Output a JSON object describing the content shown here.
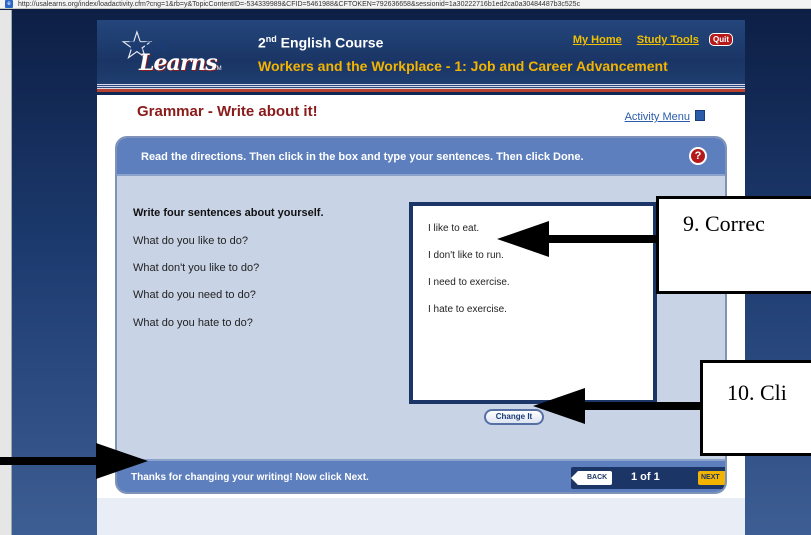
{
  "browser": {
    "url": "http://usalearns.org/index/loadactivity.cfm?cng=1&rb=y&TopicContentID=-534339989&CFID=5461988&CFTOKEN=792636658&sessionid=1a30222716b1ed2ca0a30484487b3c525c"
  },
  "header": {
    "logo_top": "U.S.A.",
    "logo_bottom": "Learns",
    "logo_tm": "TM",
    "course_prefix": "2",
    "course_sup": "nd",
    "course_suffix": " English Course",
    "unit_title": "Workers and the Workplace - 1: Job and Career Advancement",
    "my_home": "My Home",
    "study_tools": "Study Tools",
    "quit": "Quit"
  },
  "page": {
    "title": "Grammar - Write about it!",
    "activity_menu": "Activity Menu"
  },
  "panel": {
    "directions": "Read the directions. Then click in the box and type your sentences. Then click Done.",
    "help": "?",
    "prompt_title": "Write four sentences about yourself.",
    "questions": [
      "What do you like to do?",
      "What don't you like to do?",
      "What do you need to do?",
      "What do you hate to do?"
    ],
    "answers": [
      "I like to eat.",
      "I don't like to run.",
      "I need to exercise.",
      "I hate to exercise."
    ],
    "change_button": "Change It"
  },
  "status": {
    "text": "Thanks for changing your writing! Now click Next.",
    "back": "BACK",
    "page_count": "1 of 1",
    "next": "NEXT"
  },
  "annotations": {
    "callout_9": "9. Correc",
    "callout_10": "10. Cli"
  }
}
